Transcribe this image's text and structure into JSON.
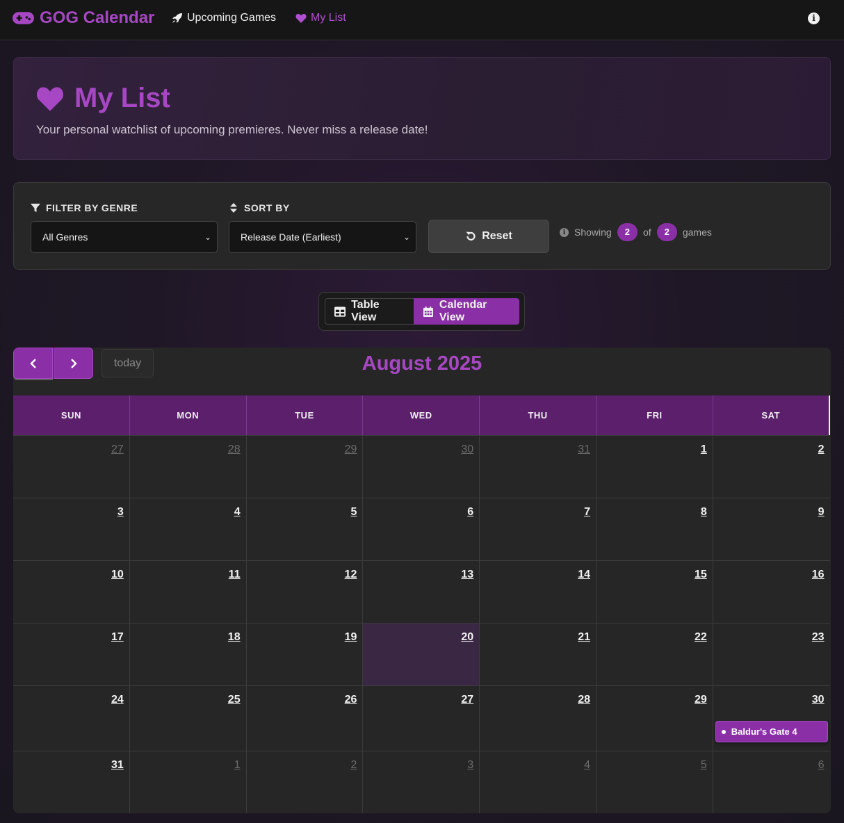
{
  "nav": {
    "brand": "GOG Calendar",
    "links": [
      {
        "label": "Upcoming Games",
        "icon": "rocket-icon"
      },
      {
        "label": "My List",
        "icon": "heart-icon"
      }
    ],
    "info_icon": "info-icon"
  },
  "hero": {
    "title": "My List",
    "subtitle": "Your personal watchlist of upcoming premieres. Never miss a release date!"
  },
  "filters": {
    "genre_label": "FILTER BY GENRE",
    "genre_value": "All Genres",
    "sort_label": "SORT BY",
    "sort_value": "Release Date (Earliest)",
    "reset_label": "Reset",
    "showing_prefix": "Showing",
    "showing_count": "2",
    "showing_of": "of",
    "showing_total": "2",
    "showing_suffix": "games"
  },
  "view_toggle": {
    "table_label": "Table View",
    "calendar_label": "Calendar View",
    "active": "calendar"
  },
  "calendar": {
    "today_label": "today",
    "month_title": "August 2025",
    "weekdays": [
      "SUN",
      "MON",
      "TUE",
      "WED",
      "THU",
      "FRI",
      "SAT"
    ],
    "weeks": [
      [
        "27",
        "28",
        "29",
        "30",
        "31",
        "1",
        "2"
      ],
      [
        "3",
        "4",
        "5",
        "6",
        "7",
        "8",
        "9"
      ],
      [
        "10",
        "11",
        "12",
        "13",
        "14",
        "15",
        "16"
      ],
      [
        "17",
        "18",
        "19",
        "20",
        "21",
        "22",
        "23"
      ],
      [
        "24",
        "25",
        "26",
        "27",
        "28",
        "29",
        "30"
      ],
      [
        "31",
        "1",
        "2",
        "3",
        "4",
        "5",
        "6"
      ]
    ],
    "today_date": "20",
    "events": [
      {
        "date": "30",
        "title": "Baldur's Gate 4"
      }
    ]
  },
  "colors": {
    "accent": "#8a2fa6",
    "brand": "#a747c4",
    "header_row": "#5b1f6c",
    "today_cell": "#3a2743"
  }
}
